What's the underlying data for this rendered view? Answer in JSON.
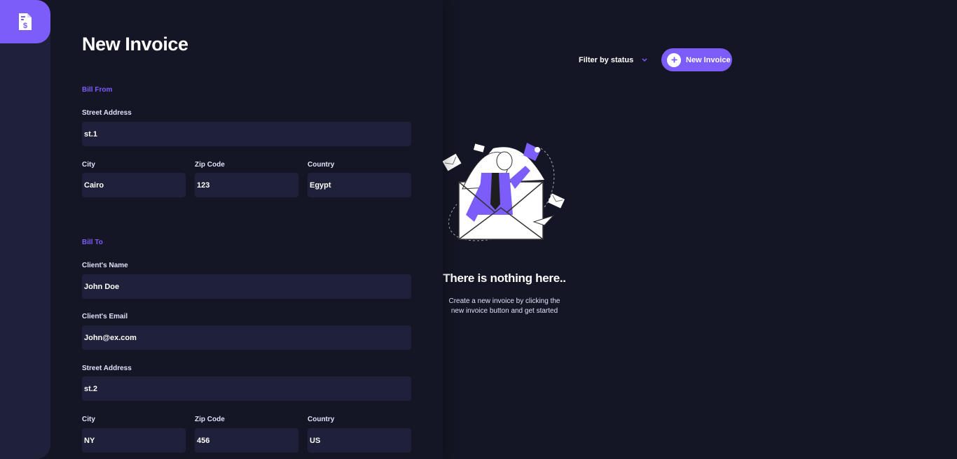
{
  "form": {
    "title": "New Invoice",
    "bill_from": {
      "section_label": "Bill From",
      "street_label": "Street Address",
      "street_value": "st.1",
      "city_label": "City",
      "city_value": "Cairo",
      "zip_label": "Zip Code",
      "zip_value": "123",
      "country_label": "Country",
      "country_value": "Egypt"
    },
    "bill_to": {
      "section_label": "Bill To",
      "name_label": "Client's Name",
      "name_value": "John Doe",
      "email_label": "Client's Email",
      "email_value": "John@ex.com",
      "street_label": "Street Address",
      "street_value": "st.2",
      "city_label": "City",
      "city_value": "NY",
      "zip_label": "Zip Code",
      "zip_value": "456",
      "country_label": "Country",
      "country_value": "US"
    }
  },
  "header": {
    "filter_label": "Filter by status",
    "new_button_label": "New Invoice"
  },
  "empty_state": {
    "title": "There is nothing here..",
    "line1": "Create a new invoice by clicking the",
    "line2": "new invoice button and get started"
  },
  "icons": {
    "logo": "invoice-dollar-icon",
    "filter": "chevron-down-icon",
    "new_button": "plus-icon"
  },
  "colors": {
    "accent": "#7c5dfa",
    "background": "#141625",
    "surface": "#1e2139",
    "text": "#ffffff"
  }
}
